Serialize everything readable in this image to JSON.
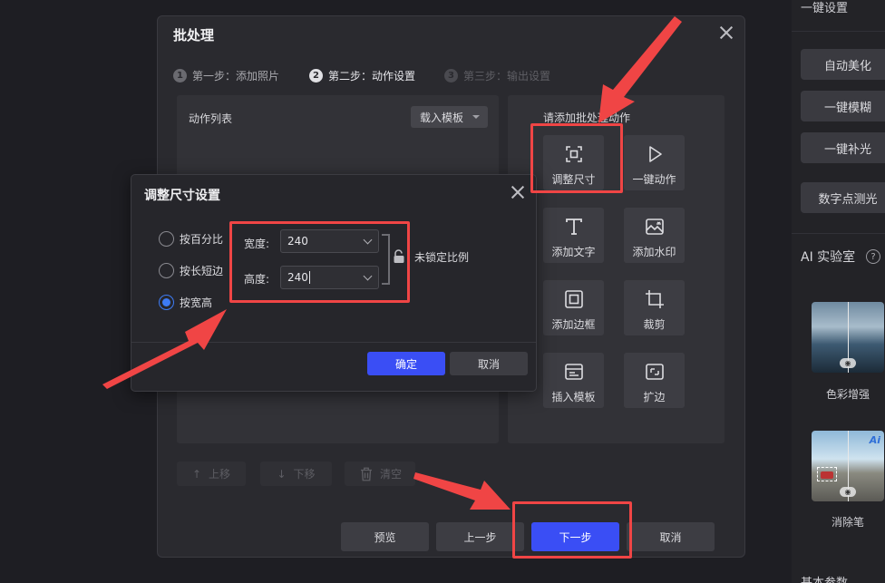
{
  "sidebar": {
    "header": "一键设置",
    "buttons": [
      "自动美化",
      "一键模糊",
      "一键补光",
      "数字点测光"
    ],
    "ai_lab": "AI 实验室",
    "help": "?",
    "thumbs": [
      {
        "caption": "色彩增强"
      },
      {
        "caption": "消除笔",
        "badge": "Ai"
      }
    ],
    "bottom": "基本参数"
  },
  "batch_dialog": {
    "title": "批处理",
    "steps": [
      {
        "num": "1",
        "label": "第一步：添加照片",
        "state": "done"
      },
      {
        "num": "2",
        "label": "第二步：动作设置",
        "state": "active"
      },
      {
        "num": "3",
        "label": "第三步：输出设置",
        "state": "pending"
      }
    ],
    "action_list_title": "动作列表",
    "load_template": "载入模板",
    "add_actions_title": "请添加批处理动作",
    "actions": [
      {
        "label": "调整尺寸",
        "icon": "resize-icon"
      },
      {
        "label": "一键动作",
        "icon": "play-icon"
      },
      {
        "label": "添加文字",
        "icon": "text-icon"
      },
      {
        "label": "添加水印",
        "icon": "watermark-icon"
      },
      {
        "label": "添加边框",
        "icon": "border-icon"
      },
      {
        "label": "裁剪",
        "icon": "crop-icon"
      },
      {
        "label": "插入模板",
        "icon": "template-icon"
      },
      {
        "label": "扩边",
        "icon": "expand-icon"
      }
    ],
    "list_buttons": {
      "up": "上移",
      "down": "下移",
      "clear": "清空"
    },
    "footer": {
      "preview": "预览",
      "prev": "上一步",
      "next": "下一步",
      "cancel": "取消"
    }
  },
  "resize_dialog": {
    "title": "调整尺寸设置",
    "modes": [
      {
        "label": "按百分比",
        "selected": false
      },
      {
        "label": "按长短边",
        "selected": false
      },
      {
        "label": "按宽高",
        "selected": true
      }
    ],
    "width_label": "宽度:",
    "width_value": "240",
    "height_label": "高度:",
    "height_value": "240",
    "lock_label": "未锁定比例",
    "ok": "确定",
    "cancel": "取消"
  },
  "colors": {
    "accent": "#3a4ef5",
    "annotation": "#f04545",
    "radio": "#3d7bf5"
  }
}
